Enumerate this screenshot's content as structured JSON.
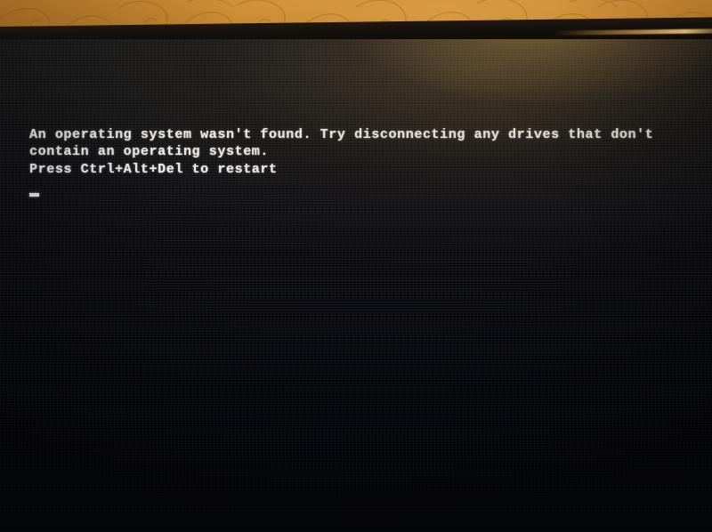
{
  "scene": {
    "subject": "photograph of a computer monitor showing a boot error",
    "wall_color": "#c6872f",
    "bezel_color": "#14100c",
    "screen_color": "#0a0a10",
    "text_color": "#f2f2f0"
  },
  "screen": {
    "message_lines": [
      "An operating system wasn't found. Try disconnecting any drives that don't",
      "contain an operating system.",
      "Press Ctrl+Alt+Del to restart"
    ],
    "line1": "An operating system wasn't found. Try disconnecting any drives that don't",
    "line2": "contain an operating system.",
    "line3": "Press Ctrl+Alt+Del to restart",
    "cursor": "_"
  }
}
